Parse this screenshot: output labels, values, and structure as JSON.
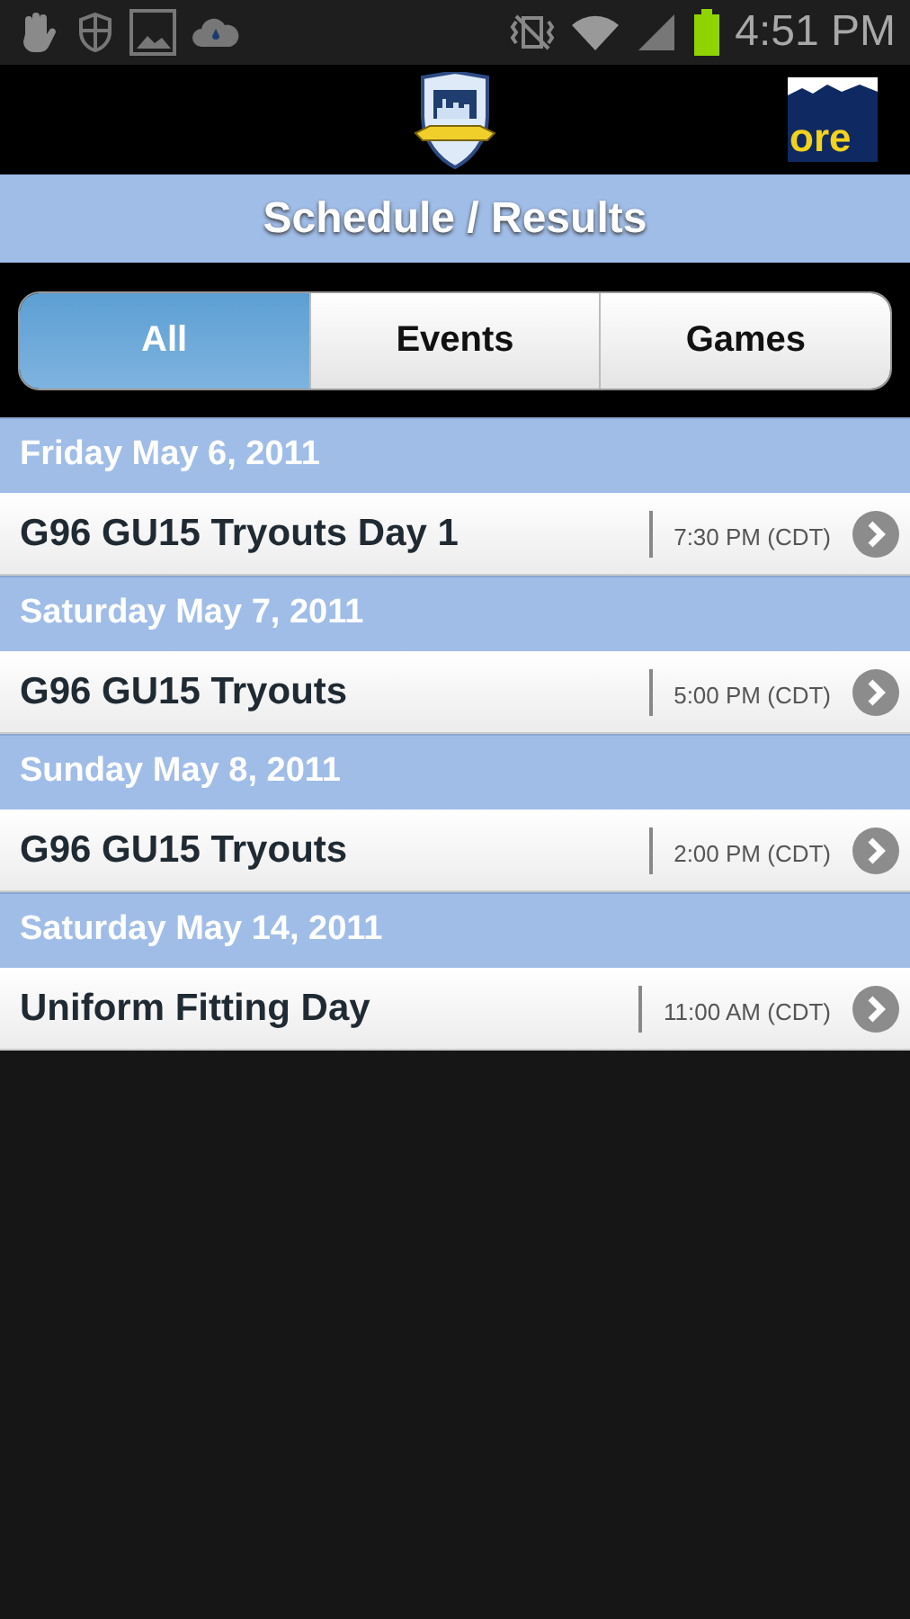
{
  "status_bar": {
    "time": "4:51 PM"
  },
  "header": {
    "sponsor_logo": {
      "text": "ore"
    }
  },
  "title": "Schedule / Results",
  "tabs": [
    {
      "label": "All",
      "selected": true
    },
    {
      "label": "Events",
      "selected": false
    },
    {
      "label": "Games",
      "selected": false
    }
  ],
  "days": [
    {
      "date": "Friday May 6, 2011",
      "events": [
        {
          "name": "G96 GU15 Tryouts Day 1",
          "time": "7:30 PM (CDT)"
        }
      ]
    },
    {
      "date": "Saturday May 7, 2011",
      "events": [
        {
          "name": "G96 GU15 Tryouts",
          "time": "5:00 PM (CDT)"
        }
      ]
    },
    {
      "date": "Sunday May 8, 2011",
      "events": [
        {
          "name": "G96 GU15 Tryouts",
          "time": "2:00 PM (CDT)"
        }
      ]
    },
    {
      "date": "Saturday May 14, 2011",
      "events": [
        {
          "name": "Uniform Fitting Day",
          "time": "11:00 AM (CDT)"
        }
      ]
    }
  ]
}
